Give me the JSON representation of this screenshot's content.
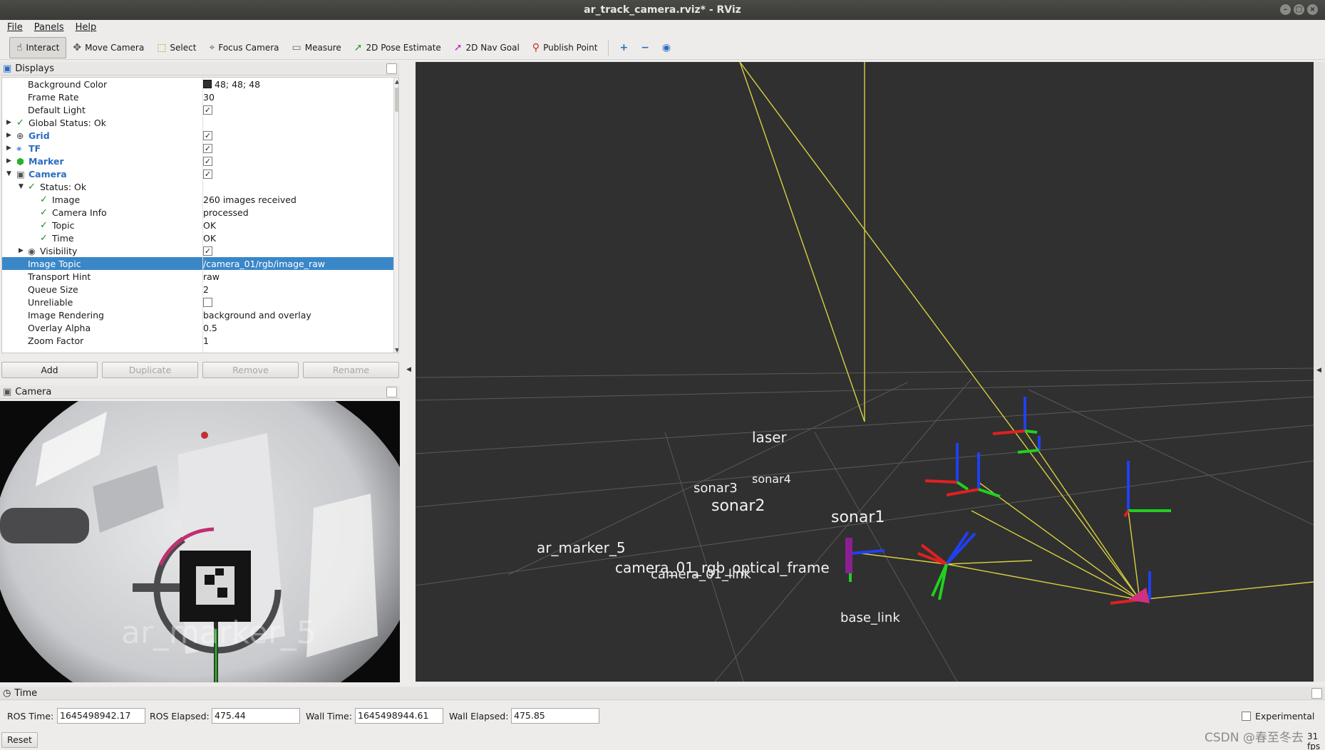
{
  "window": {
    "title": "ar_track_camera.rviz* - RViz"
  },
  "menu": [
    "File",
    "Panels",
    "Help"
  ],
  "toolbar": {
    "tools": [
      {
        "label": "Interact",
        "icon": "hand-pointer-icon",
        "glyph": "☝"
      },
      {
        "label": "Move Camera",
        "icon": "move-camera-icon",
        "glyph": "✥"
      },
      {
        "label": "Select",
        "icon": "select-box-icon",
        "glyph": "⬚"
      },
      {
        "label": "Focus Camera",
        "icon": "focus-target-icon",
        "glyph": "⌖"
      },
      {
        "label": "Measure",
        "icon": "ruler-icon",
        "glyph": "▭"
      },
      {
        "label": "2D Pose Estimate",
        "icon": "pose-arrow-icon",
        "glyph": "➚"
      },
      {
        "label": "2D Nav Goal",
        "icon": "nav-goal-arrow-icon",
        "glyph": "➚"
      },
      {
        "label": "Publish Point",
        "icon": "map-pin-icon",
        "glyph": "⚲"
      }
    ],
    "extra_icons": [
      "plus-icon",
      "minus-icon",
      "eye-icon"
    ]
  },
  "displays": {
    "title": "Displays",
    "rows": [
      {
        "name": "Background Color",
        "value": "48; 48; 48",
        "swatch": "#303030"
      },
      {
        "name": "Frame Rate",
        "value": "30"
      },
      {
        "name": "Default Light",
        "checked": true
      },
      {
        "name": "Global Status: Ok",
        "status": true
      },
      {
        "name": "Grid",
        "bold": true,
        "checked": true
      },
      {
        "name": "TF",
        "bold": true,
        "checked": true
      },
      {
        "name": "Marker",
        "bold": true,
        "checked": true
      },
      {
        "name": "Camera",
        "bold": true,
        "checked": true
      },
      {
        "name": "Status: Ok",
        "status": true
      },
      {
        "name": "Image",
        "value": "260 images received",
        "status": true
      },
      {
        "name": "Camera Info",
        "value": "processed",
        "status": true
      },
      {
        "name": "Topic",
        "value": "OK",
        "status": true
      },
      {
        "name": "Time",
        "value": "OK",
        "status": true
      },
      {
        "name": "Visibility",
        "checked": true
      },
      {
        "name": "Image Topic",
        "value": "/camera_01/rgb/image_raw",
        "selected": true
      },
      {
        "name": "Transport Hint",
        "value": "raw"
      },
      {
        "name": "Queue Size",
        "value": "2"
      },
      {
        "name": "Unreliable",
        "checked": false
      },
      {
        "name": "Image Rendering",
        "value": "background and overlay"
      },
      {
        "name": "Overlay Alpha",
        "value": "0.5"
      },
      {
        "name": "Zoom Factor",
        "value": "1"
      }
    ],
    "buttons": {
      "add": "Add",
      "duplicate": "Duplicate",
      "remove": "Remove",
      "rename": "Rename"
    }
  },
  "camera_panel": {
    "title": "Camera",
    "overlay_text": "ar_marker_5"
  },
  "scene": {
    "background": "#303030",
    "labels": {
      "laser": "laser",
      "sonar4": "sonar4",
      "sonar3": "sonar3",
      "sonar2": "sonar2",
      "sonar1": "sonar1",
      "ar_marker": "ar_marker_5",
      "camera": "camera_01_rgb_optical_frame",
      "camera_link": "camera_01_link",
      "base": "base_link"
    }
  },
  "time": {
    "title": "Time",
    "ros_time_label": "ROS Time:",
    "ros_time": "1645498942.17",
    "ros_elapsed_label": "ROS Elapsed:",
    "ros_elapsed": "475.44",
    "wall_time_label": "Wall Time:",
    "wall_time": "1645498944.61",
    "wall_elapsed_label": "Wall Elapsed:",
    "wall_elapsed": "475.85",
    "experimental": "Experimental",
    "reset": "Reset",
    "fps": "31 fps"
  },
  "watermark": "CSDN @春至冬去"
}
